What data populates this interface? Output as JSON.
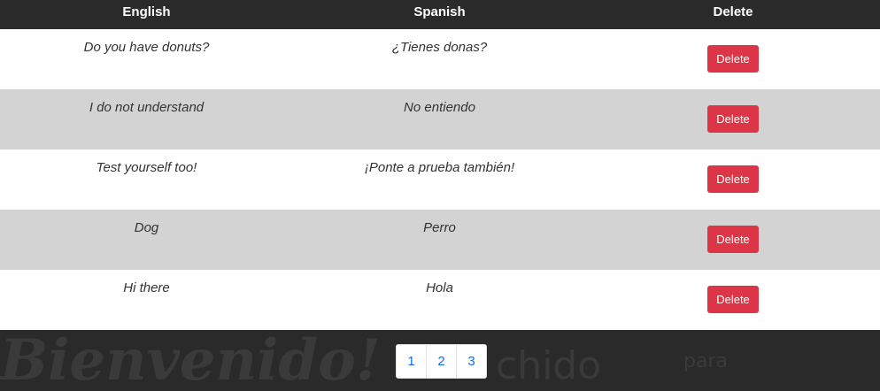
{
  "table": {
    "headers": {
      "english": "English",
      "spanish": "Spanish",
      "delete": "Delete"
    },
    "rows": [
      {
        "english": "Do you have donuts?",
        "spanish": "¿Tienes donas?",
        "action": "Delete"
      },
      {
        "english": "I do not understand",
        "spanish": "No entiendo",
        "action": "Delete"
      },
      {
        "english": "Test yourself too!",
        "spanish": "¡Ponte a prueba también!",
        "action": "Delete"
      },
      {
        "english": "Dog",
        "spanish": "Perro",
        "action": "Delete"
      },
      {
        "english": "Hi there",
        "spanish": "Hola",
        "action": "Delete"
      }
    ]
  },
  "pagination": {
    "pages": [
      "1",
      "2",
      "3"
    ]
  },
  "background_text": {
    "welcome": "Bienvenido!",
    "chido": "chido",
    "para": "para"
  },
  "colors": {
    "header_bg": "#2a2a2a",
    "row_even": "#d3d3d3",
    "delete_button": "#dc3545",
    "page_link": "#0d6efd"
  }
}
